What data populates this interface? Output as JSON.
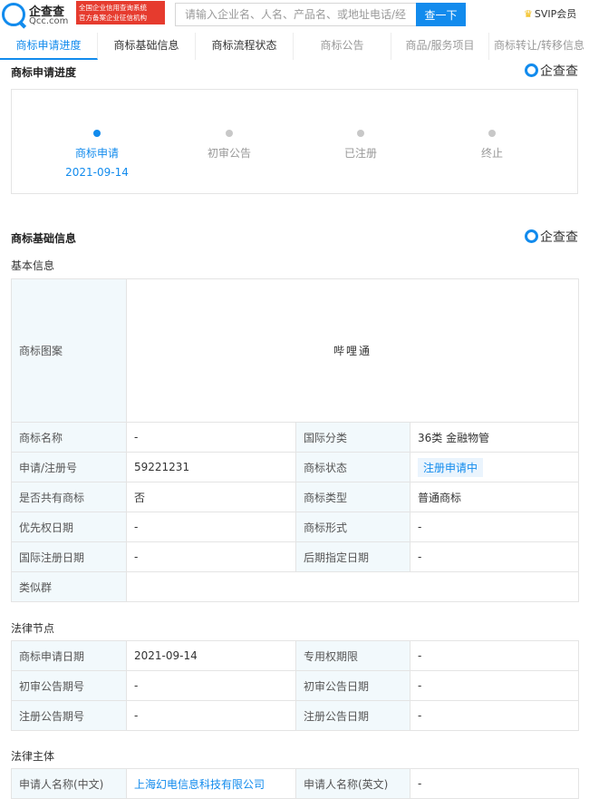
{
  "header": {
    "logo_name": "企查查",
    "logo_url": "Qcc.com",
    "badge_line1": "全国企业信用查询系统",
    "badge_line2": "官方备案企业征信机构",
    "search_placeholder": "请输入企业名、人名、产品名、或地址电话/经营?",
    "search_button": "查一下",
    "svip": "SVIP会员"
  },
  "tabs": [
    {
      "label": "商标申请进度"
    },
    {
      "label": "商标基础信息"
    },
    {
      "label": "商标流程状态"
    },
    {
      "label": "商标公告"
    },
    {
      "label": "商品/服务项目"
    },
    {
      "label": "商标转让/转移信息"
    }
  ],
  "progress": {
    "title": "商标申请进度",
    "watermark": "企查查",
    "steps": [
      {
        "label": "商标申请",
        "date": "2021-09-14"
      },
      {
        "label": "初审公告",
        "date": ""
      },
      {
        "label": "已注册",
        "date": ""
      },
      {
        "label": "终止",
        "date": ""
      }
    ]
  },
  "basic": {
    "title": "商标基础信息",
    "watermark": "企查查",
    "subtitle": "基本信息",
    "image_label": "商标图案",
    "image_text": "哔哩通",
    "rows": [
      {
        "k1": "商标名称",
        "v1": "-",
        "k2": "国际分类",
        "v2": "36类 金融物管"
      },
      {
        "k1": "申请/注册号",
        "v1": "59221231",
        "k2": "商标状态",
        "v2": "注册申请中"
      },
      {
        "k1": "是否共有商标",
        "v1": "否",
        "k2": "商标类型",
        "v2": "普通商标"
      },
      {
        "k1": "优先权日期",
        "v1": "-",
        "k2": "商标形式",
        "v2": "-"
      },
      {
        "k1": "国际注册日期",
        "v1": "-",
        "k2": "后期指定日期",
        "v2": "-"
      }
    ],
    "similar_label": "类似群",
    "similar_value": ""
  },
  "legal": {
    "title": "法律节点",
    "rows": [
      {
        "k1": "商标申请日期",
        "v1": "2021-09-14",
        "k2": "专用权期限",
        "v2": "-"
      },
      {
        "k1": "初审公告期号",
        "v1": "-",
        "k2": "初审公告日期",
        "v2": "-"
      },
      {
        "k1": "注册公告期号",
        "v1": "-",
        "k2": "注册公告日期",
        "v2": "-"
      }
    ]
  },
  "subject": {
    "title": "法律主体",
    "k1": "申请人名称(中文)",
    "v1": "上海幻电信息科技有限公司",
    "k2": "申请人名称(英文)",
    "v2": "-"
  },
  "colors": {
    "accent": "#128bed",
    "badge": "#e63b2e",
    "key_bg": "#f2f9fc"
  }
}
